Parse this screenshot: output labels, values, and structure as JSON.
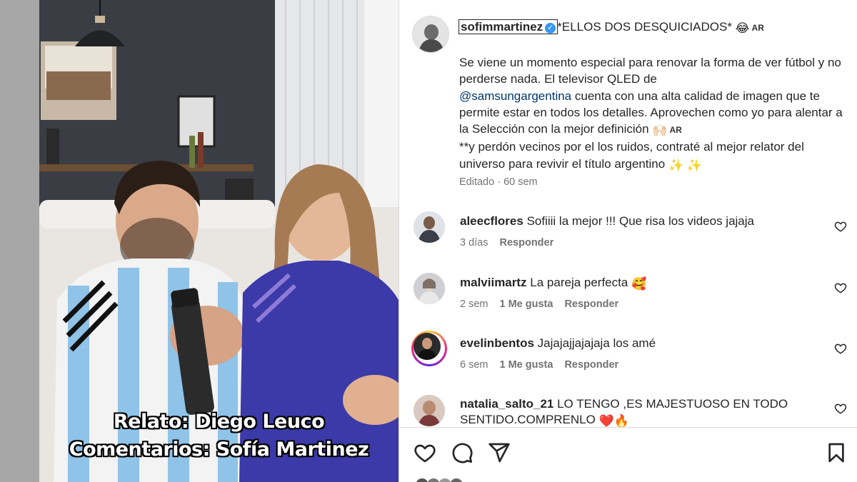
{
  "video": {
    "caption_line1": "Relato: Diego Leuco",
    "caption_line2": "Comentarios: Sofía Martinez"
  },
  "post": {
    "username": "sofimmartinez",
    "title": "*ELLOS DOS DESQUICIADOS*",
    "title_emoji": "😂",
    "country_tag": "AR",
    "body_line1": "Se viene un momento especial para renovar la forma de ver fútbol y no perderse nada. El televisor QLED de",
    "mention": "@samsungargentina",
    "body_line2": " cuenta con una alta calidad de imagen que te permite estar en todos los detalles. Aprovechen como yo para alentar a la Selección con la mejor definición",
    "body_emoji": "🙌🏻",
    "body_line3": "**y perdón vecinos por el los ruidos, contraté al mejor relator del universo para revivir el título argentino",
    "body_end_emoji": "✨ ✨",
    "edited": "Editado · 60 sem"
  },
  "comments": [
    {
      "username": "aleecflores",
      "text": "Sofiiii la mejor !!! Que risa los videos jajaja",
      "time": "3 días",
      "likes": "",
      "reply": "Responder"
    },
    {
      "username": "malviimartz",
      "text": "La pareja perfecta",
      "emoji": "🥰",
      "time": "2 sem",
      "likes": "1 Me gusta",
      "reply": "Responder"
    },
    {
      "username": "evelinbentos",
      "text": "Jajajajjajajaja los amé",
      "time": "6 sem",
      "likes": "1 Me gusta",
      "reply": "Responder"
    },
    {
      "username": "natalia_salto_21",
      "text": "LO TENGO ,ES MAJESTUOSO EN TODO",
      "text2": "SENTIDO.COMPRENLO",
      "emoji": "❤️🔥",
      "time": "",
      "likes": "",
      "reply": ""
    }
  ],
  "icons": {
    "like": "heart-icon",
    "comment": "comment-icon",
    "share": "share-icon",
    "save": "bookmark-icon"
  },
  "colors": {
    "verified": "#3897f0",
    "mention": "#00376b",
    "meta": "#737373"
  }
}
